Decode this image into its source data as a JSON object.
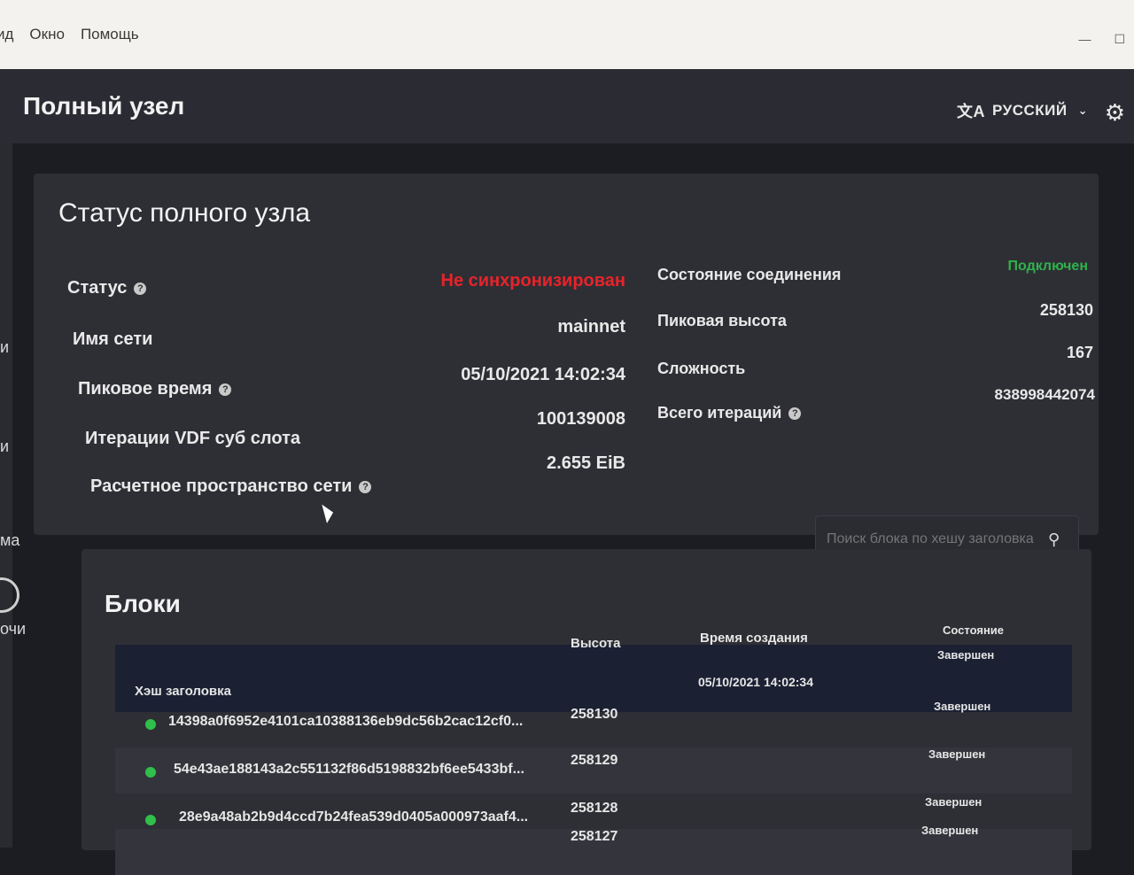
{
  "menubar": {
    "items": [
      "ид",
      "Окно",
      "Помощь"
    ],
    "minimize": "—",
    "maximize": "☐"
  },
  "header": {
    "title": "Полный узел",
    "language": "РУССКИЙ",
    "language_icon": "translate-icon",
    "settings_icon": "gear-icon"
  },
  "sidebar": {
    "fragments": [
      "и",
      "и",
      "ма",
      "очи"
    ]
  },
  "status": {
    "title": "Статус полного узла",
    "left": [
      {
        "label": "Статус",
        "value": "Не синхронизирован",
        "help": true
      },
      {
        "label": "Имя сети",
        "value": "mainnet",
        "help": false
      },
      {
        "label": "Пиковое время",
        "value": "05/10/2021 14:02:34",
        "help": true
      },
      {
        "label": "Итерации VDF суб слота",
        "value": "100139008",
        "help": false
      },
      {
        "label": "Расчетное пространство сети",
        "value": "2.655 EiB",
        "help": true
      }
    ],
    "right": [
      {
        "label": "Состояние соединения",
        "value": "Подключен",
        "help": false
      },
      {
        "label": "Пиковая высота",
        "value": "258130",
        "help": false
      },
      {
        "label": "Сложность",
        "value": "167",
        "help": false
      },
      {
        "label": "Всего итераций",
        "value": "838998442074",
        "help": true
      }
    ]
  },
  "search": {
    "placeholder": "Поиск блока по хешу заголовка"
  },
  "blocks": {
    "title": "Блоки",
    "columns": [
      "Хэш заголовка",
      "Высота",
      "Время создания",
      "Состояние"
    ],
    "rows": [
      {
        "hash": "14398a0f6952e4101ca10388136eb9dc56b2cac12cf0...",
        "height": "258130",
        "time": "05/10/2021 14:02:34",
        "state": "Завершен"
      },
      {
        "hash": "54e43ae188143a2c551132f86d5198832bf6ee5433bf...",
        "height": "258129",
        "time": "",
        "state": "Завершен"
      },
      {
        "hash": "28e9a48ab2b9d4ccd7b24fea539d0405a000973aaf4...",
        "height": "258128",
        "time": "",
        "state": "Завершен"
      },
      {
        "hash": "",
        "height": "258127",
        "time": "",
        "state": "Завершен"
      }
    ],
    "extra_state": "Завершен"
  },
  "colors": {
    "status_bad": "#e8232a",
    "status_good": "#2fb24c",
    "row_dot": "#2fbf4a"
  }
}
